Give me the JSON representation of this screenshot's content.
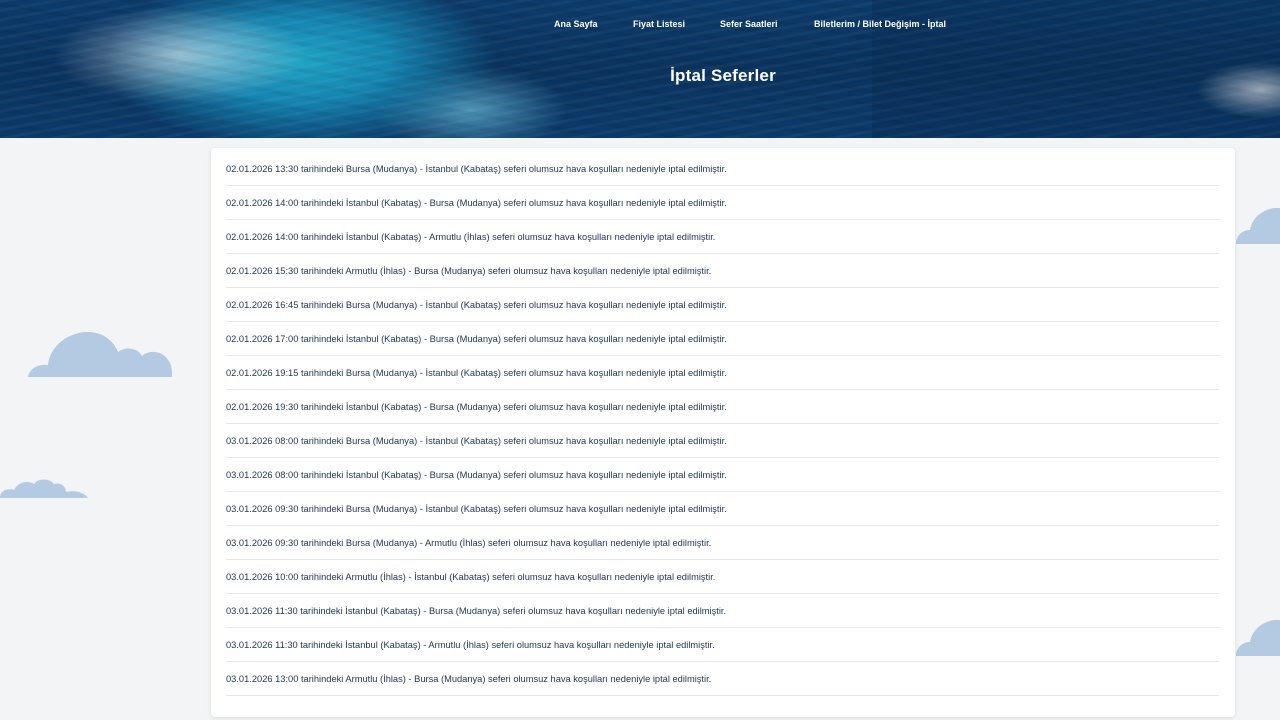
{
  "nav": {
    "items": [
      {
        "label": "Ana Sayfa"
      },
      {
        "label": "Fiyat Listesi"
      },
      {
        "label": "Sefer Saatleri"
      },
      {
        "label": "Biletlerim / Bilet Değişim - İptal"
      }
    ]
  },
  "page": {
    "title": "İptal Seferler"
  },
  "cancellations": [
    "02.01.2026 13:30 tarihindeki Bursa (Mudanya) - İstanbul (Kabataş) seferi olumsuz hava koşulları nedeniyle iptal edilmiştir.",
    "02.01.2026 14:00 tarihindeki İstanbul (Kabataş) - Bursa (Mudanya) seferi olumsuz hava koşulları nedeniyle iptal edilmiştir.",
    "02.01.2026 14:00 tarihindeki İstanbul (Kabataş) - Armutlu (İhlas) seferi olumsuz hava koşulları nedeniyle iptal edilmiştir.",
    "02.01.2026 15:30 tarihindeki Armutlu (İhlas) - Bursa (Mudanya) seferi olumsuz hava koşulları nedeniyle iptal edilmiştir.",
    "02.01.2026 16:45 tarihindeki Bursa (Mudanya) - İstanbul (Kabataş) seferi olumsuz hava koşulları nedeniyle iptal edilmiştir.",
    "02.01.2026 17:00 tarihindeki İstanbul (Kabataş) - Bursa (Mudanya) seferi olumsuz hava koşulları nedeniyle iptal edilmiştir.",
    "02.01.2026 19:15 tarihindeki Bursa (Mudanya) - İstanbul (Kabataş) seferi olumsuz hava koşulları nedeniyle iptal edilmiştir.",
    "02.01.2026 19:30 tarihindeki İstanbul (Kabataş) - Bursa (Mudanya) seferi olumsuz hava koşulları nedeniyle iptal edilmiştir.",
    "03.01.2026 08:00 tarihindeki Bursa (Mudanya) - İstanbul (Kabataş) seferi olumsuz hava koşulları nedeniyle iptal edilmiştir.",
    "03.01.2026 08:00 tarihindeki İstanbul (Kabataş) - Bursa (Mudanya) seferi olumsuz hava koşulları nedeniyle iptal edilmiştir.",
    "03.01.2026 09:30 tarihindeki Bursa (Mudanya) - İstanbul (Kabataş) seferi olumsuz hava koşulları nedeniyle iptal edilmiştir.",
    "03.01.2026 09:30 tarihindeki Bursa (Mudanya) - Armutlu (İhlas) seferi olumsuz hava koşulları nedeniyle iptal edilmiştir.",
    "03.01.2026 10:00 tarihindeki Armutlu (İhlas) - İstanbul (Kabataş) seferi olumsuz hava koşulları nedeniyle iptal edilmiştir.",
    "03.01.2026 11:30 tarihindeki İstanbul (Kabataş) - Bursa (Mudanya) seferi olumsuz hava koşulları nedeniyle iptal edilmiştir.",
    "03.01.2026 11:30 tarihindeki İstanbul (Kabataş) - Armutlu (İhlas) seferi olumsuz hava koşulları nedeniyle iptal edilmiştir.",
    "03.01.2026 13:00 tarihindeki Armutlu (İhlas) - Bursa (Mudanya) seferi olumsuz hava koşulları nedeniyle iptal edilmiştir."
  ],
  "colors": {
    "hero_base": "#0a335e",
    "text": "#1f3457",
    "cloud": "#b3cae2",
    "background": "#f3f4f6"
  }
}
